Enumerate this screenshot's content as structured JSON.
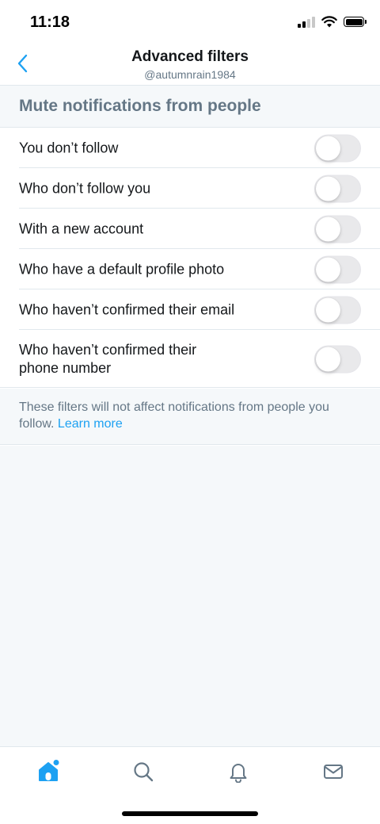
{
  "status_bar": {
    "time": "11:18",
    "icons": [
      "cellular-signal-icon",
      "wifi-icon",
      "battery-icon"
    ]
  },
  "header": {
    "back_icon": "chevron-left-icon",
    "title": "Advanced filters",
    "subtitle": "@autumnrain1984"
  },
  "section": {
    "title": "Mute notifications from people"
  },
  "filters": [
    {
      "label": "You don’t follow",
      "enabled": false
    },
    {
      "label": "Who don’t follow you",
      "enabled": false
    },
    {
      "label": "With a new account",
      "enabled": false
    },
    {
      "label": "Who have a default profile photo",
      "enabled": false
    },
    {
      "label": "Who haven’t confirmed their email",
      "enabled": false
    },
    {
      "label": "Who haven’t confirmed their phone number",
      "enabled": false
    }
  ],
  "note": {
    "text": "These filters will not affect notifications from people you follow.",
    "link": "Learn more"
  },
  "tab_bar": {
    "tabs": [
      "home-icon",
      "search-icon",
      "notifications-bell-icon",
      "messages-envelope-icon"
    ],
    "active": "home-icon"
  },
  "colors": {
    "accent": "#1da1f2",
    "secondary_text": "#657786",
    "toggle_off": "#e9e9eb",
    "background": "#f5f8fa"
  }
}
